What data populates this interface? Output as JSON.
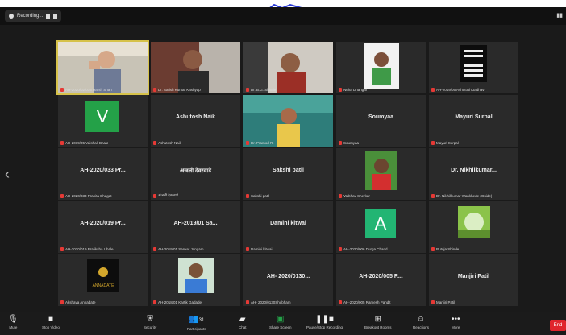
{
  "recording": {
    "label": "Recording..."
  },
  "participants": [
    {
      "name": "",
      "display": "AH-2020/02/015 Harsh Shah"
    },
    {
      "name": "",
      "display": "Dr. Satish Kumar Kashyap"
    },
    {
      "name": "",
      "display": "Dr. B.G. Shinde"
    },
    {
      "name": "",
      "display": "Neha Dhangar"
    },
    {
      "name": "",
      "display": "AH-2019/05 Ashutosh Jadhav"
    },
    {
      "name": "",
      "display": "AH-2019/05 Vaishali Bhala",
      "avatar": "V"
    },
    {
      "name": "Ashutosh Naik",
      "display": "Ashutosh Naik"
    },
    {
      "name": "",
      "display": "Dr. Pramod R."
    },
    {
      "name": "Soumyaa",
      "display": "Soumyaa"
    },
    {
      "name": "Mayuri Surpal",
      "display": "Mayuri Surpal"
    },
    {
      "name": "AH-2020/033 Pr...",
      "display": "AH-2020/033 Pranita Bhagat"
    },
    {
      "name": "अंजली देवरवाडे",
      "display": "अंजली देवरवाडे"
    },
    {
      "name": "Sakshi patil",
      "display": "Sakshi patil"
    },
    {
      "name": "",
      "display": "Vaibhav Sherkar"
    },
    {
      "name": "Dr. Nikhilkumar...",
      "display": "Dr. Nikhilkumar Wankhede (Guide)"
    },
    {
      "name": "AH-2020/019 Pr...",
      "display": "AH-2020/019 Pratiksha Ubale"
    },
    {
      "name": "AH-2019/01 Sa...",
      "display": "AH-2019/01 Sanket Jangam"
    },
    {
      "name": "Damini kitwai",
      "display": "Damini kitwai"
    },
    {
      "name": "",
      "display": "AH-2020/006 Durga Chand",
      "avatar": "A"
    },
    {
      "name": "",
      "display": "Rutuja Shinde"
    },
    {
      "name": "",
      "display": "Akshaya Annadate",
      "logo": "ANNADATE"
    },
    {
      "name": "",
      "display": "AH-2018/01 Kartik Gadade"
    },
    {
      "name": "AH- 2020/0130...",
      "display": "AH- 2020/0130Shubham"
    },
    {
      "name": "AH-2020/005 R...",
      "display": "AH-2020/005 Ramesh Pandit"
    },
    {
      "name": "Manjiri Patil",
      "display": "Manjiri Patil"
    }
  ],
  "toolbar": {
    "mute": "Mute",
    "stop_video": "Stop Video",
    "security": "Security",
    "participants": "Participants",
    "participants_count": "31",
    "chat": "Chat",
    "share_screen": "Share Screen",
    "share_pause": "Pause/Stop Recording",
    "breakout": "Breakout Rooms",
    "reactions": "Reactions",
    "more": "More",
    "end": "End"
  },
  "colors": {
    "accent_green": "#24a148",
    "end_red": "#e0252c",
    "selected_outline": "#d6c24a"
  }
}
